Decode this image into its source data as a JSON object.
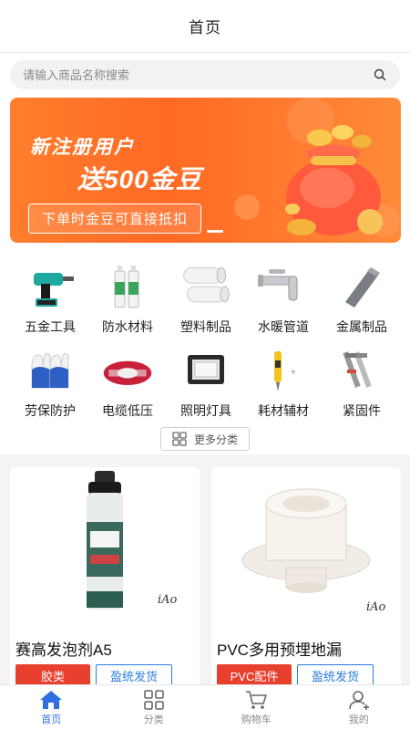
{
  "header": {
    "title": "首页"
  },
  "search": {
    "placeholder": "请输入商品名称搜索",
    "icon": "search-icon"
  },
  "banner": {
    "line1": "新注册用户",
    "line2": "送500金豆",
    "pill": "下单时金豆可直接抵扣",
    "colors": {
      "from": "#ff7e2d",
      "to": "#ff8a3a"
    }
  },
  "categories": [
    {
      "label": "五金工具",
      "icon": "drill-icon"
    },
    {
      "label": "防水材料",
      "icon": "sealant-tubes-icon"
    },
    {
      "label": "塑料制品",
      "icon": "plastic-rolls-icon"
    },
    {
      "label": "水暖管道",
      "icon": "faucet-icon"
    },
    {
      "label": "金属制品",
      "icon": "metal-bar-icon"
    },
    {
      "label": "劳保防护",
      "icon": "gloves-icon"
    },
    {
      "label": "电缆低压",
      "icon": "cable-coil-icon"
    },
    {
      "label": "照明灯具",
      "icon": "floodlight-icon"
    },
    {
      "label": "耗材辅材",
      "icon": "test-pen-icon"
    },
    {
      "label": "紧固件",
      "icon": "anchor-bolt-icon"
    }
  ],
  "more": {
    "label": "更多分类",
    "icon": "grid-icon"
  },
  "products": [
    {
      "name": "赛高发泡剂A5",
      "tag": "胶类",
      "ship": "盈统发货"
    },
    {
      "name": "PVC多用预埋地漏",
      "tag": "PVC配件",
      "ship": "盈统发货"
    }
  ],
  "tabbar": [
    {
      "label": "首页",
      "icon": "home-icon",
      "active": true
    },
    {
      "label": "分类",
      "icon": "grid-icon"
    },
    {
      "label": "购物车",
      "icon": "cart-icon"
    },
    {
      "label": "我的",
      "icon": "user-icon"
    }
  ],
  "colors": {
    "accent": "#2d6fde",
    "tag_red": "#e8402f",
    "tag_blue": "#2a7de0"
  }
}
